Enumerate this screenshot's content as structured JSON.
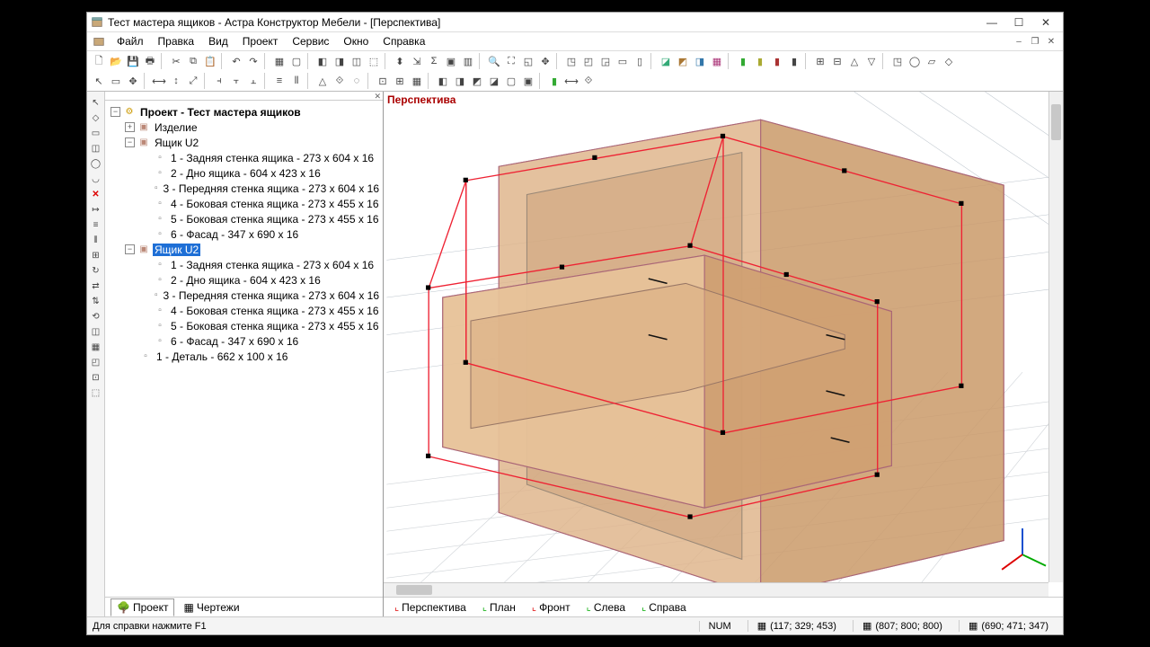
{
  "titlebar": {
    "title": "Тест мастера ящиков - Астра Конструктор Мебели - [Перспектива]"
  },
  "menu": {
    "file": "Файл",
    "edit": "Правка",
    "view": "Вид",
    "project": "Проект",
    "service": "Сервис",
    "window": "Окно",
    "help": "Справка"
  },
  "tree": {
    "root": "Проект - Тест мастера ящиков",
    "item1": "Изделие",
    "drawer1": "Ящик U2",
    "drawer1_parts": {
      "p1": "1 - Задняя стенка ящика - 273 x 604 x 16",
      "p2": "2 - Дно ящика - 604 x 423 x 16",
      "p3": "3 - Передняя стенка ящика - 273 x 604 x 16",
      "p4": "4 - Боковая стенка ящика - 273 x 455 x 16",
      "p5": "5 - Боковая стенка ящика - 273 x 455 x 16",
      "p6": "6 - Фасад - 347 x 690 x 16"
    },
    "drawer2": "Ящик U2",
    "drawer2_parts": {
      "p1": "1 - Задняя стенка ящика - 273 x 604 x 16",
      "p2": "2 - Дно ящика - 604 x 423 x 16",
      "p3": "3 - Передняя стенка ящика - 273 x 604 x 16",
      "p4": "4 - Боковая стенка ящика - 273 x 455 x 16",
      "p5": "5 - Боковая стенка ящика - 273 x 455 x 16",
      "p6": "6 - Фасад - 347 x 690 x 16"
    },
    "detail": "1 - Деталь - 662 x 100 x 16"
  },
  "viewport": {
    "label": "Перспектива"
  },
  "panel_tabs": {
    "project": "Проект",
    "drawings": "Чертежи"
  },
  "view_tabs": {
    "perspective": "Перспектива",
    "plan": "План",
    "front": "Фронт",
    "left": "Слева",
    "right": "Справа"
  },
  "status": {
    "hint": "Для справки нажмите F1",
    "num": "NUM",
    "coord1": "(117; 329; 453)",
    "coord2": "(807; 800; 800)",
    "coord3": "(690; 471; 347)"
  }
}
